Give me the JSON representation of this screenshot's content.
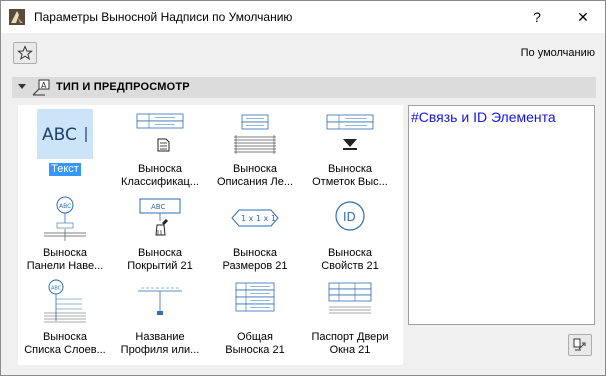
{
  "window": {
    "title": "Параметры Выносной Надписи по Умолчанию",
    "help_label": "?",
    "close_label": "✕"
  },
  "toolbar": {
    "favorites_icon": "star-icon",
    "default_label": "По умолчанию"
  },
  "section": {
    "title": "ТИП И ПРЕДПРОСМОТР",
    "expanded": true
  },
  "tiles": [
    {
      "line1": "Текст",
      "line2": "",
      "icon": "text-abc-icon",
      "selected": true
    },
    {
      "line1": "Выноска",
      "line2": "Классификац...",
      "icon": "classification-label-icon",
      "selected": false
    },
    {
      "line1": "Выноска",
      "line2": "Описания Ле...",
      "icon": "stair-description-label-icon",
      "selected": false
    },
    {
      "line1": "Выноска",
      "line2": "Отметок Выс...",
      "icon": "elevation-label-icon",
      "selected": false
    },
    {
      "line1": "Выноска",
      "line2": "Панели Наве...",
      "icon": "curtain-panel-label-icon",
      "selected": false
    },
    {
      "line1": "Выноска",
      "line2": "Покрытий 21",
      "icon": "surface-label-icon",
      "selected": false
    },
    {
      "line1": "Выноска",
      "line2": "Размеров 21",
      "icon": "dimension-label-icon",
      "selected": false
    },
    {
      "line1": "Выноска",
      "line2": "Свойств 21",
      "icon": "property-id-label-icon",
      "selected": false
    },
    {
      "line1": "Выноска",
      "line2": "Списка Слоев...",
      "icon": "layer-list-label-icon",
      "selected": false
    },
    {
      "line1": "Название",
      "line2": "Профиля или...",
      "icon": "profile-name-label-icon",
      "selected": false
    },
    {
      "line1": "Общая",
      "line2": "Выноска 21",
      "icon": "general-label-icon",
      "selected": false
    },
    {
      "line1": "Паспорт Двери",
      "line2": "Окна 21",
      "icon": "door-window-passport-icon",
      "selected": false
    }
  ],
  "preview": {
    "text": "#Связь и ID Элемента",
    "text_color": "#1414e6"
  },
  "footer": {
    "corner_icon": "transfer-settings-icon"
  },
  "colors": {
    "selection": "#3399ff",
    "selection_bg": "#cce4f7",
    "icon_blue": "#2e6db4"
  }
}
